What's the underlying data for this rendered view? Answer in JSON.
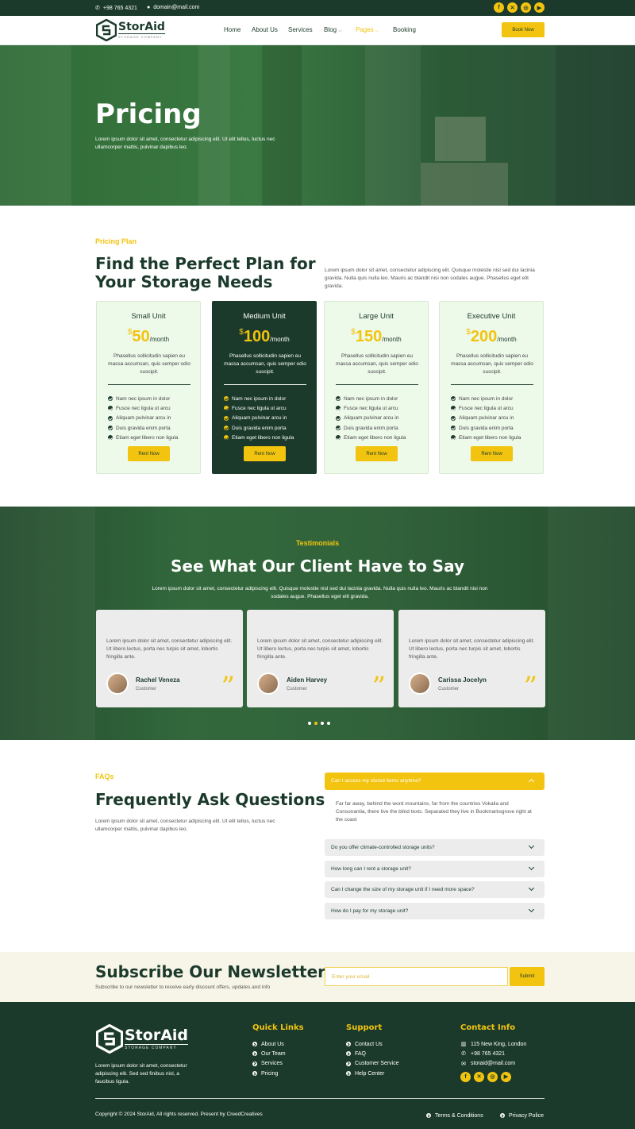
{
  "topbar": {
    "phone": "+98 765 4321",
    "email": "domain@mail.com",
    "socials": [
      "facebook-icon",
      "x-icon",
      "instagram-icon",
      "youtube-icon"
    ]
  },
  "brand": {
    "name": "StorAid",
    "tagline": "STORAGE COMPANY"
  },
  "nav": {
    "items": [
      "Home",
      "About Us",
      "Services",
      "Blog",
      "Pages",
      "Booking"
    ],
    "active": "Pages",
    "cta": "Book Now"
  },
  "hero": {
    "title": "Pricing",
    "text": "Lorem ipsum dolor sit amet, consectetur adipiscing elit. Ut elit tellus, luctus nec ullamcorper mattis, pulvinar dapibus leo."
  },
  "pricing": {
    "eyebrow": "Pricing Plan",
    "title_line1": "Find the Perfect Plan for",
    "title_line2": "Your Storage Needs",
    "text": "Lorem ipsum dolor sit amet, consectetur adipiscing elit. Quisque molestie nisl sed dui lacinia gravida. Nulla quis nulla leo. Mauris ac blandit nisi non sodales augue. Phasellus eget elit gravida.",
    "currency": "$",
    "per": "/month",
    "plans": [
      {
        "name": "Small Unit",
        "price": "50",
        "desc": "Phasellus sollicitudin sapien eu massa accumsan, quis semper odio suscipit.",
        "button": "Rent Now"
      },
      {
        "name": "Medium Unit",
        "price": "100",
        "desc": "Phasellus sollicitudin sapien eu massa accumsan, quis semper odio suscipit.",
        "button": "Rent Now"
      },
      {
        "name": "Large Unit",
        "price": "150",
        "desc": "Phasellus sollicitudin sapien eu massa accumsan, quis semper odio suscipit.",
        "button": "Rent Now"
      },
      {
        "name": "Executive Unit",
        "price": "200",
        "desc": "Phasellus sollicitudin sapien eu massa accumsan, quis semper odio suscipit.",
        "button": "Rent Now"
      }
    ],
    "features": [
      "Nam nec ipsum in dolor",
      "Fusce nec ligula ut arcu",
      "Aliquam pulvinar arcu in",
      "Duis gravida enim porta",
      "Etiam eget libero non ligula"
    ]
  },
  "testimonials": {
    "eyebrow": "Testimonials",
    "title": "See What Our Client Have to Say",
    "text": "Lorem ipsum dolor sit amet, consectetur adipiscing elit. Quisque molestie nisl sed dui lacinia gravida. Nulla quis nulla leo. Mauris ac blandit nisi non sodales augue. Phasellus eget elit gravida.",
    "items": [
      {
        "quote": "Lorem ipsum dolor sit amet, consectetur adipiscing elit. Ut libero lectus, porta nec turpis sit amet, lobortis fringilla ante.",
        "name": "Rachel Veneza",
        "role": "Customer"
      },
      {
        "quote": "Lorem ipsum dolor sit amet, consectetur adipiscing elit. Ut libero lectus, porta nec turpis sit amet, lobortis fringilla ante.",
        "name": "Aiden Harvey",
        "role": "Customer"
      },
      {
        "quote": "Lorem ipsum dolor sit amet, consectetur adipiscing elit. Ut libero lectus, porta nec turpis sit amet, lobortis fringilla ante.",
        "name": "Carissa Jocelyn",
        "role": "Customer"
      }
    ],
    "dots": 4,
    "active_dot": 2
  },
  "faq": {
    "eyebrow": "FAQs",
    "title": "Frequently Ask Questions",
    "text": "Lorem ipsum dolor sit amet, consectetur adipiscing elit. Ut elit tellus, luctus nec ullamcorper mattis, pulvinar dapibus leo.",
    "open_question": "Can I access my stored items anytime?",
    "open_answer": "Far far away, behind the word mountains, far from the countries Vokalia and Consonantia, there live the blind texts. Separated they live in Bookmarksgrove right at the coast",
    "questions": [
      "Do you offer climate-controlled storage units?",
      "How long can I rent a storage unit?",
      "Can I change the size of my storage unit if I need more space?",
      "How do I pay for my storage unit?"
    ]
  },
  "newsletter": {
    "title": "Subscribe Our Newsletter",
    "text": "Subscribe to our newsletter to receive early discount offers, updates and info",
    "placeholder": "Enter your email",
    "button": "Submit"
  },
  "footer": {
    "about": "Lorem ipsum dolor sit amet, consectetur adipiscing elit. Sed sed finibus nisl, a faucibus ligula.",
    "quick_title": "Quick Links",
    "quick": [
      "About Us",
      "Our Team",
      "Services",
      "Pricing"
    ],
    "support_title": "Support",
    "support": [
      "Contact Us",
      "FAQ",
      "Customer Service",
      "Help Center"
    ],
    "contact_title": "Contact Info",
    "address": "115 New King, London",
    "phone": "+98 765 4321",
    "email": "storaid@mail.com",
    "copyright": "Copyright © 2024 StorAid, All rights reserved. Present by CreedCreatives",
    "terms": "Terms & Conditions",
    "privacy": "Privacy Police"
  },
  "colors": {
    "primary": "#1b3a2b",
    "accent": "#f2c40f",
    "light": "#edf9e9"
  }
}
